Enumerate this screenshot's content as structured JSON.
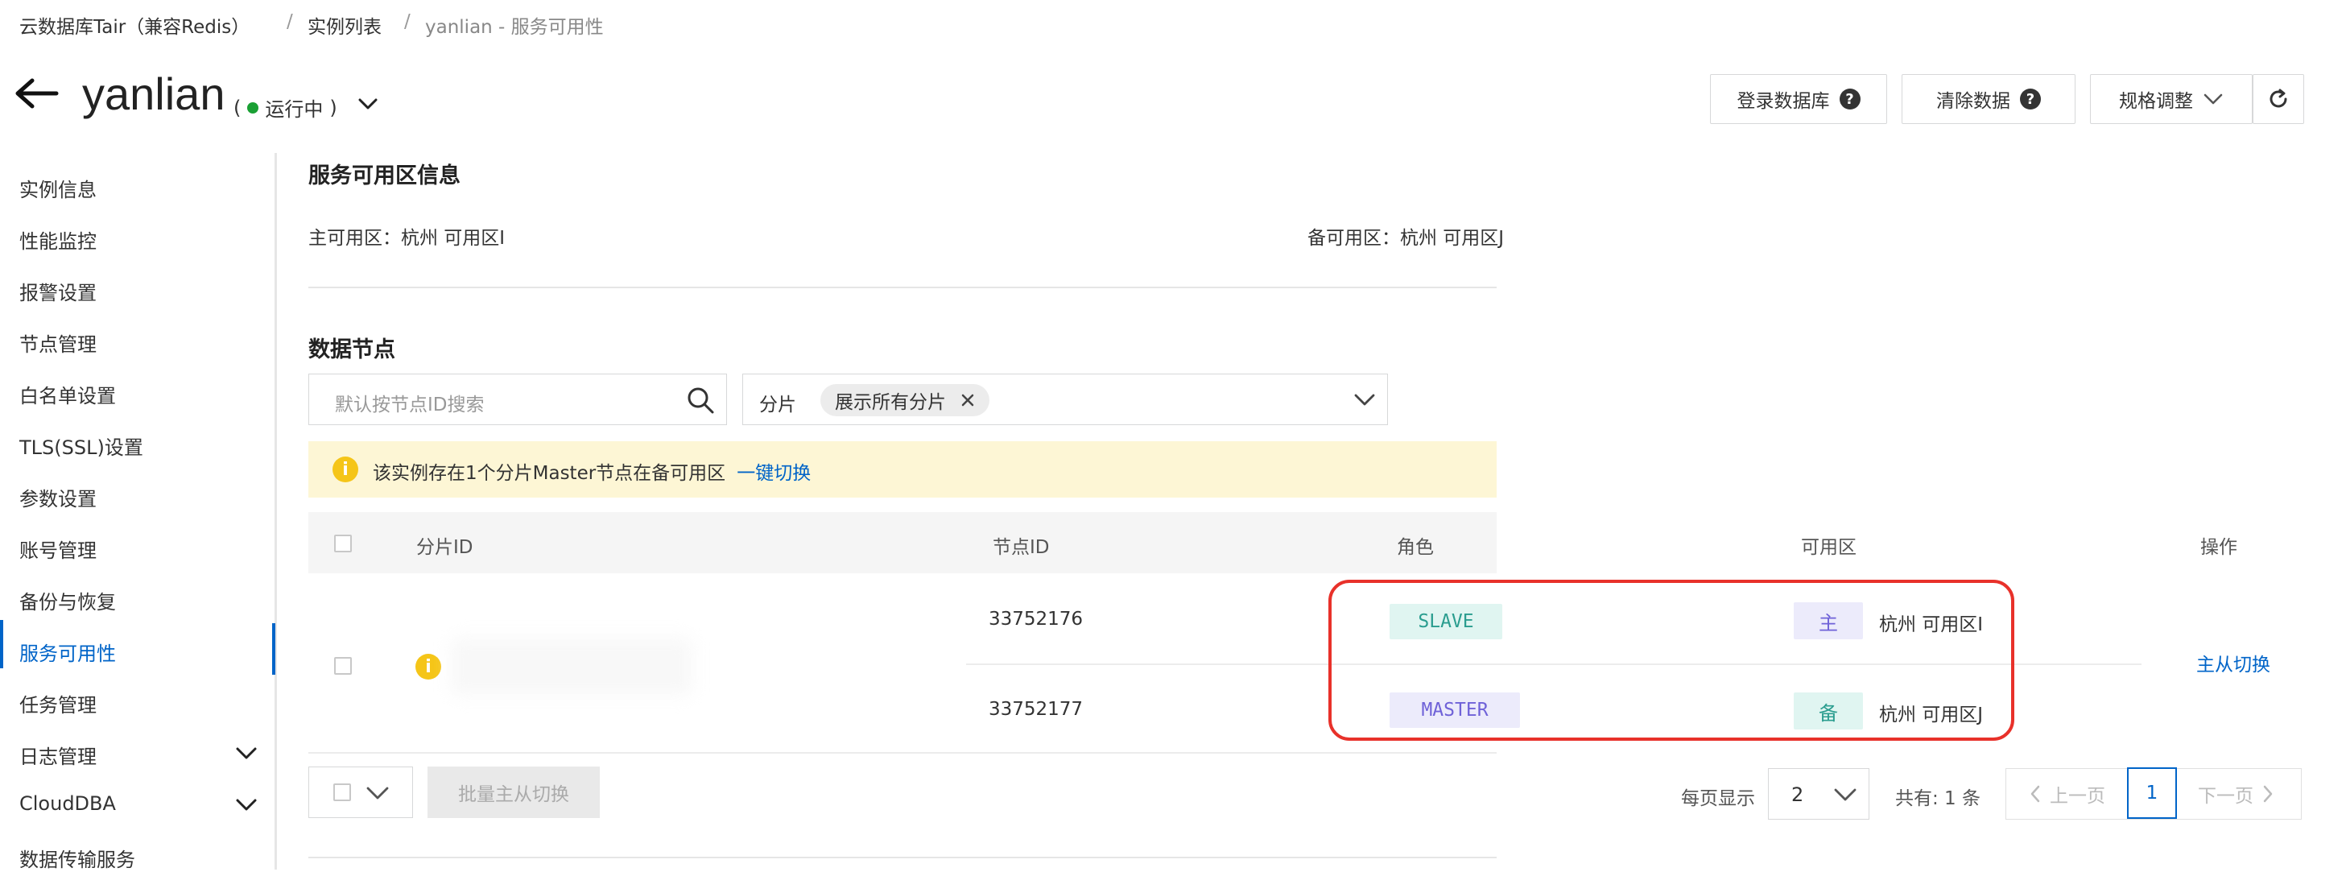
{
  "breadcrumb": {
    "items": [
      "云数据库Tair（兼容Redis）",
      "实例列表",
      "yanlian - 服务可用性"
    ],
    "separator": "/"
  },
  "header": {
    "instance_name": "yanlian",
    "status_open": "(",
    "status": "运行中",
    "status_close": ")",
    "buttons": {
      "login_db": "登录数据库",
      "clear_data": "清除数据",
      "spec_change": "规格调整"
    }
  },
  "sidebar": {
    "items": [
      {
        "label": "实例信息"
      },
      {
        "label": "性能监控"
      },
      {
        "label": "报警设置"
      },
      {
        "label": "节点管理"
      },
      {
        "label": "白名单设置"
      },
      {
        "label": "TLS(SSL)设置"
      },
      {
        "label": "参数设置"
      },
      {
        "label": "账号管理"
      },
      {
        "label": "备份与恢复"
      },
      {
        "label": "服务可用性"
      },
      {
        "label": "任务管理"
      },
      {
        "label": "日志管理"
      },
      {
        "label": "CloudDBA"
      },
      {
        "label": "数据传输服务"
      }
    ],
    "active": "服务可用性"
  },
  "zone_info": {
    "title": "服务可用区信息",
    "primary": "主可用区：杭州 可用区I",
    "secondary": "备可用区：杭州 可用区J"
  },
  "nodes": {
    "title": "数据节点",
    "search_placeholder": "默认按节点ID搜索",
    "shard_label": "分片",
    "shard_tag": "展示所有分片",
    "notice": "该实例存在1个分片Master节点在备可用区",
    "notice_link": "一键切换",
    "columns": [
      "分片ID",
      "节点ID",
      "角色",
      "可用区",
      "操作"
    ],
    "rows": [
      {
        "node_id": "33752176",
        "role": "SLAVE",
        "zone_tag": "主",
        "zone": "杭州 可用区I"
      },
      {
        "node_id": "33752177",
        "role": "MASTER",
        "zone_tag": "备",
        "zone": "杭州 可用区J"
      }
    ],
    "action": "主从切换"
  },
  "footer": {
    "bulk_button": "批量主从切换",
    "page_size_label": "每页显示",
    "page_size": "2",
    "total": "共有: 1 条",
    "prev": "上一页",
    "current_page": "1",
    "next": "下一页"
  },
  "colors": {
    "accent": "#0064c8",
    "status_running": "#1aa034",
    "highlight": "#e8312a",
    "notice_bg": "#fdf6d5",
    "slave_tag_bg": "#e0f5f1",
    "master_tag_bg": "#ecebfb"
  }
}
